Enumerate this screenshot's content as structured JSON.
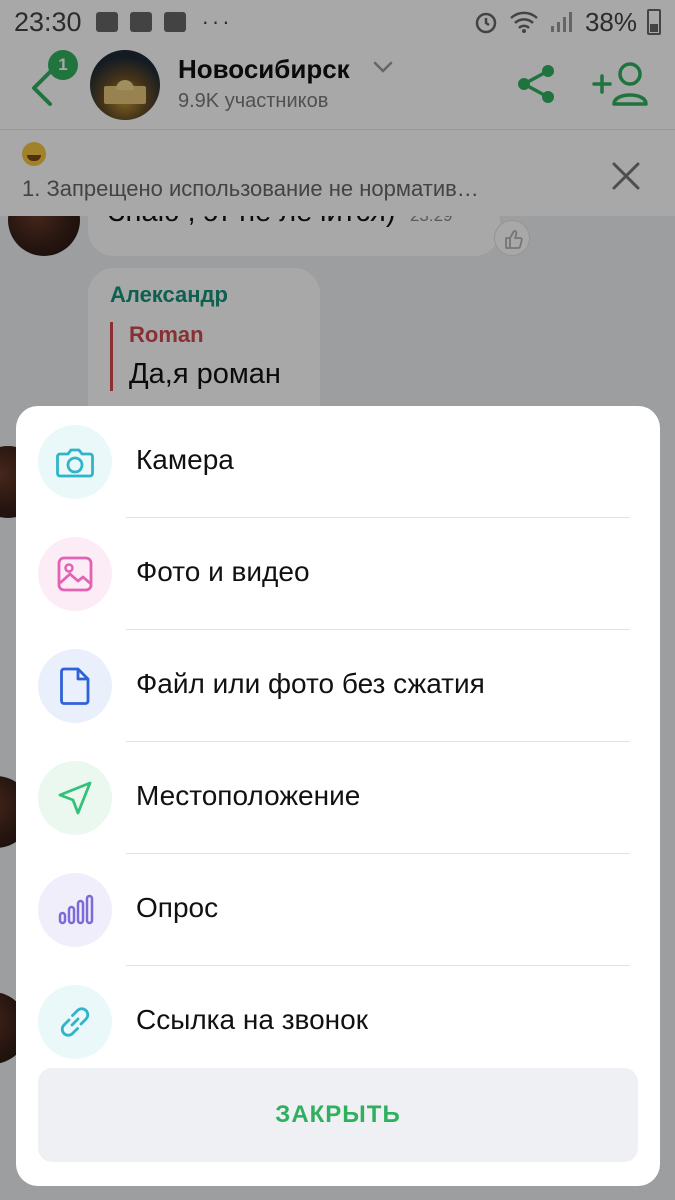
{
  "status_bar": {
    "time": "23:30",
    "dots": "···",
    "battery": "38%"
  },
  "header": {
    "back_badge": "1",
    "title": "Новосибирск",
    "subtitle": "9.9K участников"
  },
  "pinned": {
    "text": "1. Запрещено использование не норматив…"
  },
  "messages": [
    {
      "text": "Знаю , эт не лечится)",
      "time": "23:29"
    },
    {
      "sender": "Александр",
      "quote_name": "Roman",
      "quote_text": "Да,я роман"
    }
  ],
  "sheet": {
    "items": [
      {
        "label": "Камера",
        "icon": "camera-icon",
        "color": "#2fb4c8",
        "bg": "#eaf8fa"
      },
      {
        "label": "Фото и видео",
        "icon": "image-icon",
        "color": "#e262b6",
        "bg": "#fcecf6"
      },
      {
        "label": "Файл или фото без сжатия",
        "icon": "file-icon",
        "color": "#2f62d8",
        "bg": "#eaf0fb"
      },
      {
        "label": "Местоположение",
        "icon": "location-arrow-icon",
        "color": "#35c07a",
        "bg": "#eaf8f0"
      },
      {
        "label": "Опрос",
        "icon": "poll-icon",
        "color": "#7d6ad6",
        "bg": "#f0eefa"
      },
      {
        "label": "Ссылка на звонок",
        "icon": "link-icon",
        "color": "#2fb4c8",
        "bg": "#eaf8fa"
      }
    ],
    "close_label": "ЗАКРЫТЬ"
  },
  "colors": {
    "accent": "#2fb05f",
    "sender": "#16927a",
    "quote": "#cf4b4f"
  }
}
